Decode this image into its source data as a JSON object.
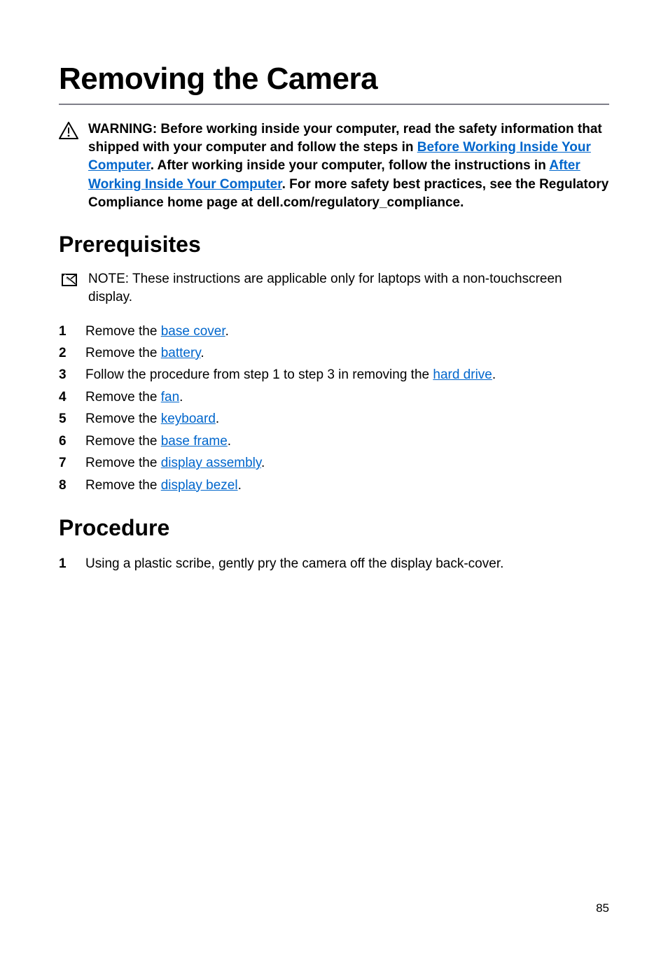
{
  "title": "Removing the Camera",
  "warning": {
    "pre1": "WARNING: Before working inside your computer, read the safety information that shipped with your computer and follow the steps in ",
    "link1": "Before Working Inside Your Computer",
    "mid1": ". After working inside your computer, follow the instructions in ",
    "link2": "After Working Inside Your Computer",
    "post1": ". For more safety best practices, see the Regulatory Compliance home page at dell.com/regulatory_compliance."
  },
  "sections": {
    "prereq_heading": "Prerequisites",
    "procedure_heading": "Procedure"
  },
  "note": {
    "label": "NOTE: ",
    "text": "These instructions are applicable only for laptops with a non-touchscreen display."
  },
  "prereq": [
    {
      "pre": "Remove the ",
      "link": "base cover",
      "post": "."
    },
    {
      "pre": "Remove the ",
      "link": "battery",
      "post": "."
    },
    {
      "pre": "Follow the procedure from step 1 to step 3 in removing the ",
      "link": "hard drive",
      "post": "."
    },
    {
      "pre": "Remove the ",
      "link": "fan",
      "post": "."
    },
    {
      "pre": "Remove the ",
      "link": "keyboard",
      "post": "."
    },
    {
      "pre": "Remove the ",
      "link": "base frame",
      "post": "."
    },
    {
      "pre": "Remove the ",
      "link": "display assembly",
      "post": "."
    },
    {
      "pre": "Remove the ",
      "link": "display bezel",
      "post": "."
    }
  ],
  "procedure": [
    {
      "text": "Using a plastic scribe, gently pry the camera off the display back-cover."
    }
  ],
  "page_number": "85"
}
